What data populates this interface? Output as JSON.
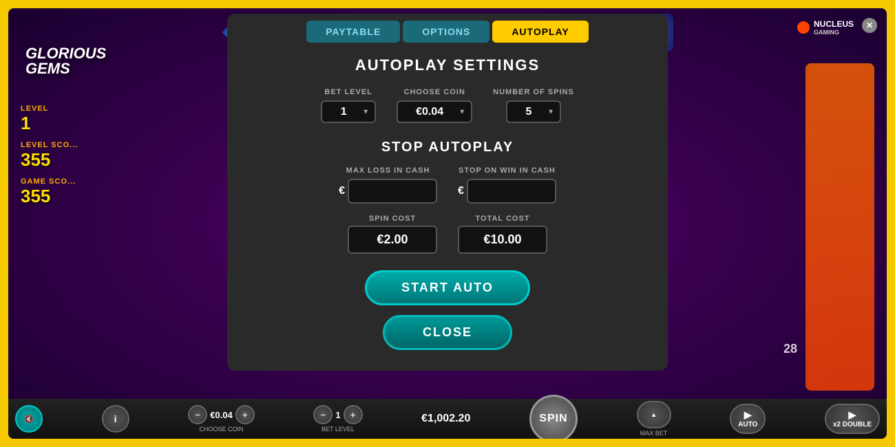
{
  "branding": {
    "game_title_line1": "GLORIOUS",
    "game_title_line2": "GEMS",
    "nucleus_label": "NUCLEUS",
    "nucleus_sub": "GAMING"
  },
  "tabs": {
    "paytable": "PAYTABLE",
    "options": "OPTIONS",
    "autoplay": "AUTOPLAY"
  },
  "modal": {
    "title": "AUTOPLAY SETTINGS",
    "stop_title": "STOP AUTOPLAY",
    "bet_level_label": "BET LEVEL",
    "bet_level_value": "1",
    "choose_coin_label": "CHOOSE COIN",
    "choose_coin_value": "€0.04",
    "num_spins_label": "NUMBER OF SPINS",
    "num_spins_value": "5",
    "max_loss_label": "MAX LOSS IN CASH",
    "max_loss_euro": "€",
    "max_loss_value": "",
    "stop_win_label": "STOP ON WIN IN CASH",
    "stop_win_euro": "€",
    "stop_win_value": "",
    "spin_cost_label": "SPIN COST",
    "spin_cost_value": "€2.00",
    "total_cost_label": "TOTAL COST",
    "total_cost_value": "€10.00",
    "start_auto_label": "START AUTO",
    "close_label": "CLOSE"
  },
  "bottom_bar": {
    "choose_coin_label": "CHOOSE COIN",
    "choose_coin_value": "€0.04",
    "bet_level_label": "BET LEVEL",
    "bet_level_value": "1",
    "bet_level_text": "BET LEVEL",
    "balance_value": "€1,002.20",
    "spin_label": "SPIN",
    "max_bet_label": "MAX BET",
    "auto_label": "AUTO",
    "double_label": "x2 DOUBLE"
  },
  "level_info": {
    "level_label": "LEVEL",
    "level_value": "1",
    "level_score_label": "LEVEL SCO...",
    "level_score_value": "355",
    "game_score_label": "GAME SCO...",
    "game_score_value": "355"
  },
  "bottom_bar_number": "28",
  "close_x": "✕"
}
